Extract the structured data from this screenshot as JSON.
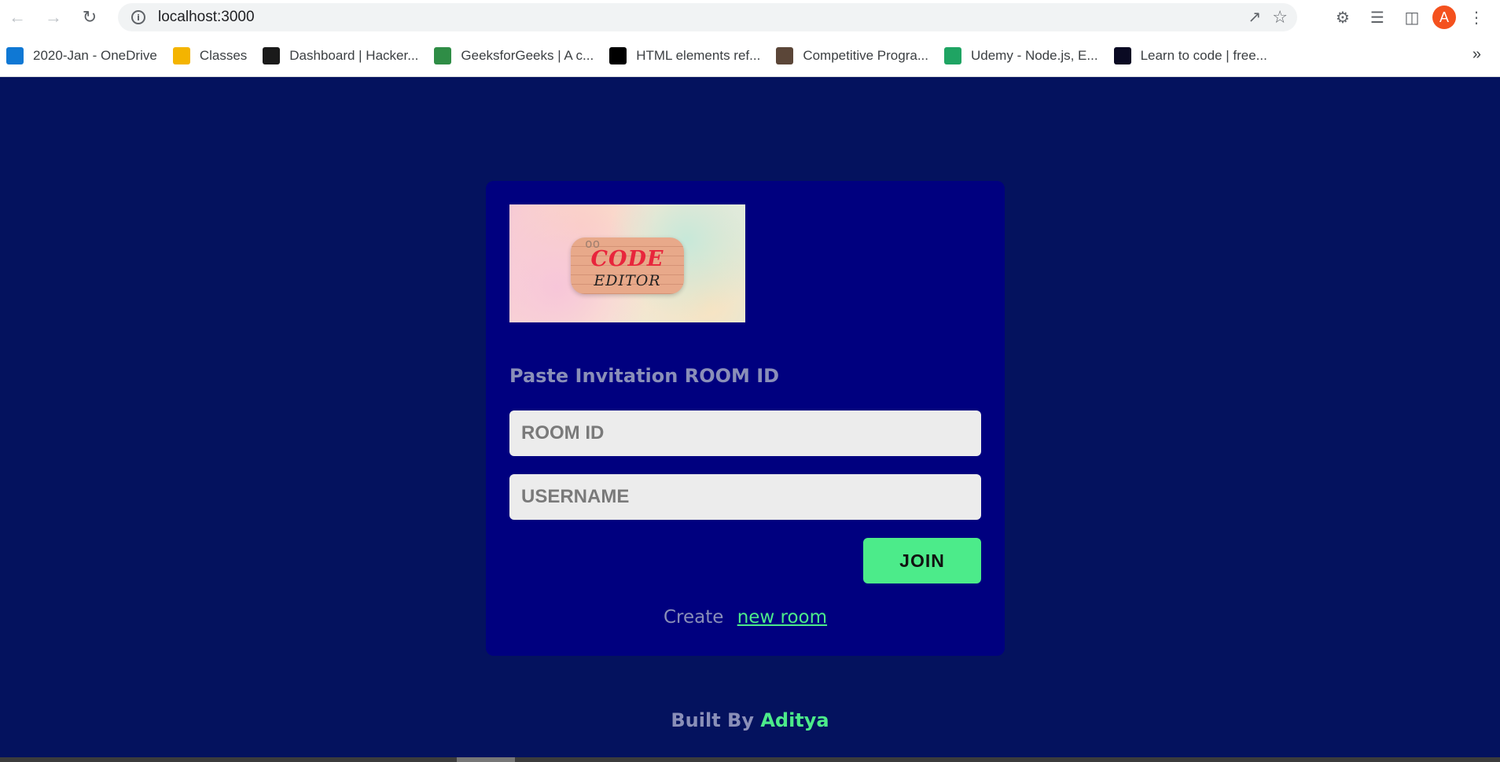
{
  "browser": {
    "url": "localhost:3000",
    "avatar_letter": "A",
    "bookmarks": [
      {
        "label": "2020-Jan - OneDrive",
        "icon": "onedrive-icon",
        "color": "#0f78d4"
      },
      {
        "label": "Classes",
        "icon": "classroom-icon",
        "color": "#f4b400"
      },
      {
        "label": "Dashboard | Hacker...",
        "icon": "hackerrank-icon",
        "color": "#1a1a1a"
      },
      {
        "label": "GeeksforGeeks | A c...",
        "icon": "geeksforgeeks-icon",
        "color": "#2f8d46"
      },
      {
        "label": "HTML elements ref...",
        "icon": "mdn-icon",
        "color": "#000000"
      },
      {
        "label": "Competitive Progra...",
        "icon": "codechef-icon",
        "color": "#5b4638"
      },
      {
        "label": "Udemy - Node.js, E...",
        "icon": "google-drive-icon",
        "color": "#1fa463"
      },
      {
        "label": "Learn to code | free...",
        "icon": "freecodecamp-icon",
        "color": "#0a0a23"
      }
    ],
    "more_bookmarks": "»"
  },
  "logo": {
    "line1": "CODE",
    "line2": "EDITOR",
    "mark": "oo"
  },
  "form": {
    "heading": "Paste Invitation ROOM ID",
    "room_placeholder": "ROOM ID",
    "username_placeholder": "USERNAME",
    "join_label": "JOIN",
    "create_text": "Create",
    "create_link": "new room"
  },
  "footer": {
    "prefix": "Built By",
    "name": "Aditya"
  },
  "colors": {
    "page_bg": "#04125e",
    "card_bg": "#00007f",
    "accent": "#4ceb8a",
    "muted_text": "#8a8fb8"
  }
}
